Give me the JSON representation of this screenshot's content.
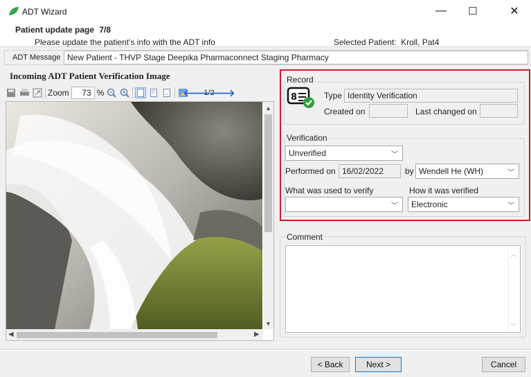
{
  "window": {
    "title": "ADT Wizard",
    "min_glyph": "—",
    "max_glyph": "☐",
    "close_glyph": "✕"
  },
  "header": {
    "page_title": "Patient update page",
    "page_number": "7/8",
    "instruction": "Please update the patient's info with the ADT info",
    "selected_patient_label": "Selected Patient:",
    "selected_patient_value": "Kroll, Pat4"
  },
  "adt_message": {
    "label": "ADT Message",
    "value": "New Patient - THVP Stage Deepika Pharmaconnect Staging Pharmacy"
  },
  "image_panel": {
    "title": "Incoming ADT Patient Verification Image",
    "zoom_label": "Zoom",
    "zoom_value": "73",
    "zoom_unit": "%",
    "page_indicator": "1/2"
  },
  "record": {
    "legend": "Record",
    "type_label": "Type",
    "type_value": "Identity Verification",
    "created_label": "Created on",
    "created_value": "",
    "changed_label": "Last changed on",
    "changed_value": ""
  },
  "verification": {
    "legend": "Verification",
    "status_value": "Unverified",
    "performed_label": "Performed on",
    "performed_value": "16/02/2022",
    "by_label": "by",
    "by_value": "Wendell He (WH)",
    "used_label": "What was used to verify",
    "used_value": "",
    "how_label": "How it was verified",
    "how_value": "Electronic"
  },
  "comment": {
    "legend": "Comment",
    "value": ""
  },
  "footer": {
    "back_label": "< Back",
    "next_label": "Next >",
    "cancel_label": "Cancel"
  },
  "colors": {
    "highlight_border": "#d11a2a",
    "accent_green": "#2e9d3c",
    "nav_arrow_blue": "#1a5fd8"
  }
}
